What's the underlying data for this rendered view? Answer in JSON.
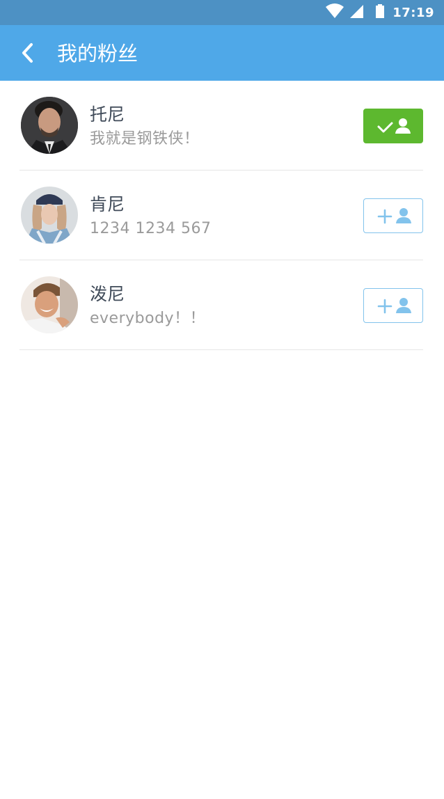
{
  "status_bar": {
    "time": "17:19",
    "icons": [
      "wifi-icon",
      "signal-icon",
      "battery-icon"
    ]
  },
  "header": {
    "title": "我的粉丝",
    "back_icon": "chevron-left-icon"
  },
  "colors": {
    "status_bar": "#4d91c4",
    "app_bar": "#4fa8e8",
    "followed_button": "#5db82f",
    "follow_button_border": "#82c3ec"
  },
  "fans": [
    {
      "name": "托尼",
      "description": "我就是钢铁侠！",
      "followed": true,
      "button_icon": "check-user-icon"
    },
    {
      "name": "肯尼",
      "description": "1234 1234 567",
      "followed": false,
      "button_icon": "add-user-icon"
    },
    {
      "name": "泼尼",
      "description": "everybody！！",
      "followed": false,
      "button_icon": "add-user-icon"
    }
  ]
}
